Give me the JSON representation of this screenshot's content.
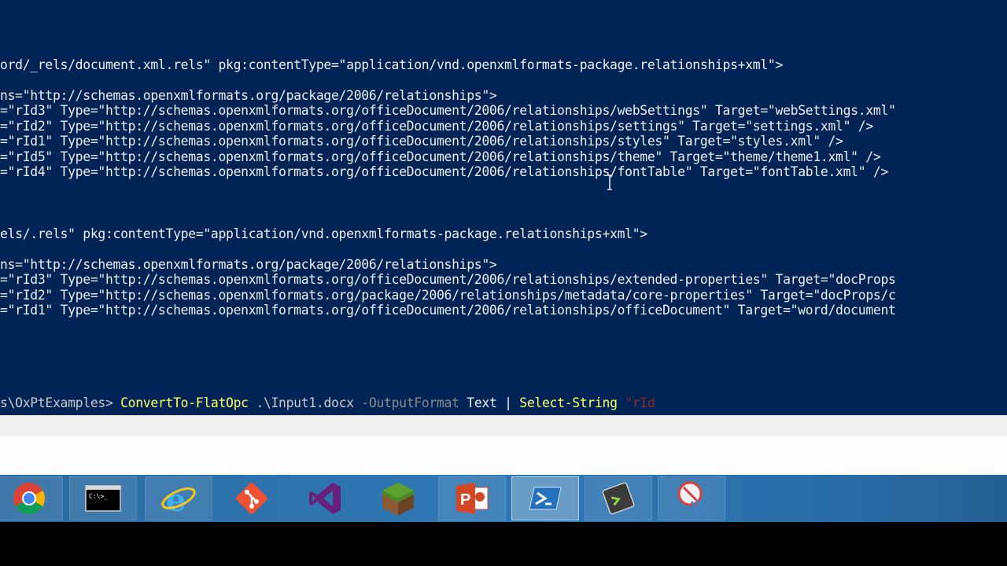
{
  "console": {
    "lines": [
      "ord/_rels/document.xml.rels\" pkg:contentType=\"application/vnd.openxmlformats-package.relationships+xml\">",
      "ns=\"http://schemas.openxmlformats.org/package/2006/relationships\">",
      "=\"rId3\" Type=\"http://schemas.openxmlformats.org/officeDocument/2006/relationships/webSettings\" Target=\"webSettings.xml\"",
      "=\"rId2\" Type=\"http://schemas.openxmlformats.org/officeDocument/2006/relationships/settings\" Target=\"settings.xml\" />",
      "=\"rId1\" Type=\"http://schemas.openxmlformats.org/officeDocument/2006/relationships/styles\" Target=\"styles.xml\" />",
      "=\"rId5\" Type=\"http://schemas.openxmlformats.org/officeDocument/2006/relationships/theme\" Target=\"theme/theme1.xml\" />",
      "=\"rId4\" Type=\"http://schemas.openxmlformats.org/officeDocument/2006/relationships/fontTable\" Target=\"fontTable.xml\" />",
      "els/.rels\" pkg:contentType=\"application/vnd.openxmlformats-package.relationships+xml\">",
      "ns=\"http://schemas.openxmlformats.org/package/2006/relationships\">",
      "=\"rId3\" Type=\"http://schemas.openxmlformats.org/officeDocument/2006/relationships/extended-properties\" Target=\"docProps",
      "=\"rId2\" Type=\"http://schemas.openxmlformats.org/package/2006/relationships/metadata/core-properties\" Target=\"docProps/c",
      "=\"rId1\" Type=\"http://schemas.openxmlformats.org/officeDocument/2006/relationships/officeDocument\" Target=\"word/document"
    ],
    "prompt": {
      "path": "s\\OxPtExamples> ",
      "command": "ConvertTo-FlatOpc",
      "arg1": ".\\Input1.docx",
      "param": "-OutputFormat",
      "value": "Text",
      "pipe": "|",
      "command2": "Select-String",
      "string": "\"rId"
    }
  },
  "taskbar": {
    "items": [
      {
        "name": "chrome-icon"
      },
      {
        "name": "command-prompt-icon"
      },
      {
        "name": "internet-explorer-icon"
      },
      {
        "name": "git-icon"
      },
      {
        "name": "visual-studio-icon"
      },
      {
        "name": "minecraft-icon"
      },
      {
        "name": "powerpoint-icon"
      },
      {
        "name": "powershell-icon"
      },
      {
        "name": "powershell-ise-icon"
      },
      {
        "name": "snipping-tool-icon"
      }
    ]
  },
  "colors": {
    "console_bg": "#012456",
    "console_text": "#eeedf0",
    "cmdlet": "#ffff66",
    "taskbar": "#2f78b5"
  }
}
